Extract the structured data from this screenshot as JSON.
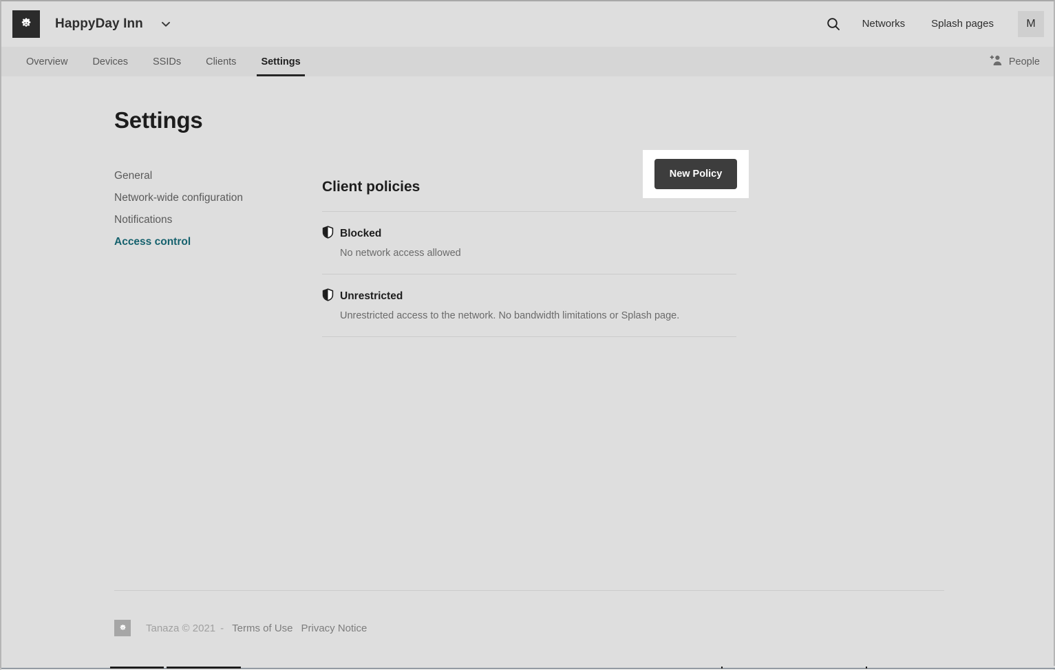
{
  "header": {
    "org_name": "HappyDay Inn",
    "chevron_icon": "chevron-down-icon",
    "logo_icon": "tanaza-logo-icon",
    "search_icon": "search-icon",
    "links": [
      {
        "label": "Networks"
      },
      {
        "label": "Splash pages"
      }
    ],
    "avatar_initial": "M"
  },
  "navbar": {
    "tabs": [
      {
        "label": "Overview",
        "active": false
      },
      {
        "label": "Devices",
        "active": false
      },
      {
        "label": "SSIDs",
        "active": false
      },
      {
        "label": "Clients",
        "active": false
      },
      {
        "label": "Settings",
        "active": true
      }
    ],
    "people": {
      "label": "People",
      "icon": "add-person-icon"
    }
  },
  "page": {
    "title": "Settings"
  },
  "settings_nav": {
    "items": [
      {
        "label": "General",
        "active": false
      },
      {
        "label": "Network-wide configuration",
        "active": false
      },
      {
        "label": "Notifications",
        "active": false
      },
      {
        "label": "Access control",
        "active": true
      }
    ]
  },
  "policies": {
    "title": "Client policies",
    "new_policy_label": "New Policy",
    "items": [
      {
        "icon": "shield-half-icon",
        "name": "Blocked",
        "description": "No network access allowed"
      },
      {
        "icon": "shield-half-icon",
        "name": "Unrestricted",
        "description": "Unrestricted access to the network. No bandwidth limitations or Splash page."
      }
    ]
  },
  "footer": {
    "logo_icon": "tanaza-logo-icon",
    "copyright": "Tanaza © 2021",
    "dash": "-",
    "terms_label": "Terms of Use",
    "privacy_label": "Privacy Notice"
  },
  "colors": {
    "accent_teal": "#15616d",
    "button_dark": "#3d3d3d",
    "page_bg": "#dedede",
    "navbar_bg": "#d6d6d6",
    "highlight_box": "#ffffff"
  }
}
